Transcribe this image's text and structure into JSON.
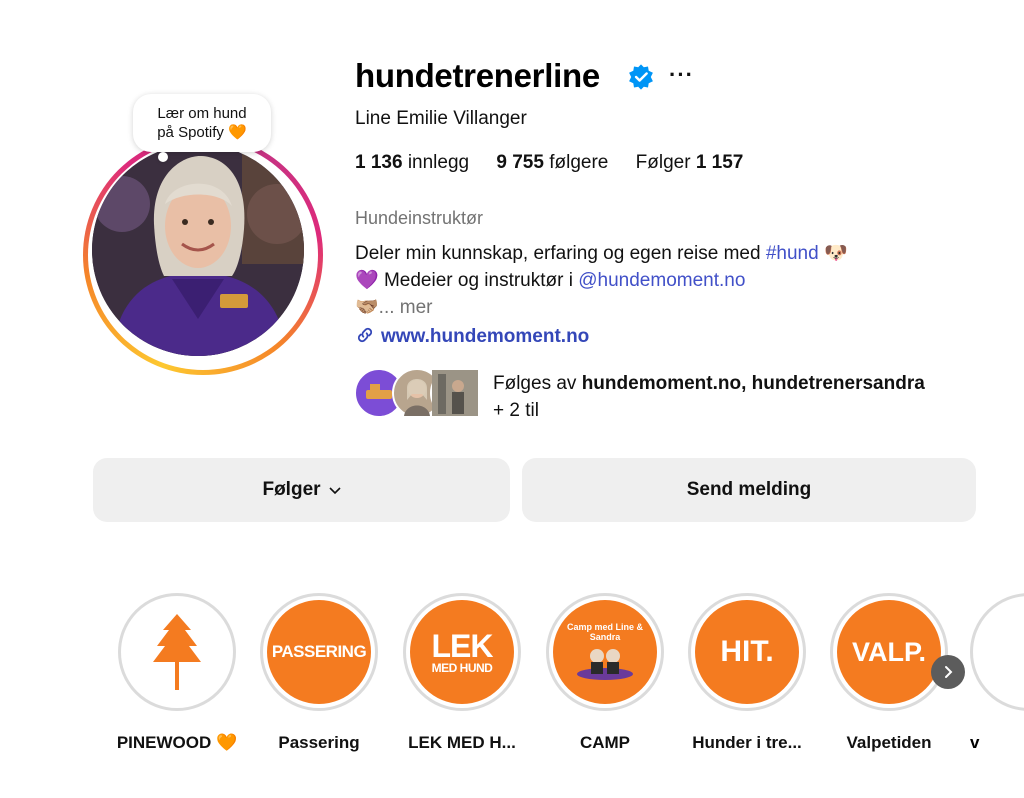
{
  "profile": {
    "username": "hundetrenerline",
    "more_icon": "···",
    "full_name": "Line Emilie Villanger",
    "note_line1": "Lær om hund",
    "note_line2": "på Spotify 🧡",
    "stats": {
      "posts_value": "1 136",
      "posts_label": "innlegg",
      "followers_value": "9 755",
      "followers_label": "følgere",
      "following_label": "Følger",
      "following_value": "1 157"
    },
    "category": "Hundeinstruktør",
    "bio": {
      "line1_text": "Deler min kunnskap, erfaring og egen reise med ",
      "line1_hashtag": "#hund",
      "line1_emoji": "🐶",
      "line2_emoji": "💜",
      "line2_text": " Medeier og instruktør i ",
      "line2_mention": "@hundemoment.no",
      "line3_emoji": "🫱🏼‍🫲🏽",
      "line3_more": "... mer"
    },
    "website": "www.hundemoment.no",
    "followed_by": {
      "prefix": "Følges av ",
      "names": "hundemoment.no, hundetrenersandra",
      "suffix": "+ 2 til"
    }
  },
  "buttons": {
    "follow_label": "Følger",
    "message_label": "Send melding"
  },
  "highlights": [
    {
      "label": "PINEWOOD 🧡",
      "cover_text": ""
    },
    {
      "label": "Passering",
      "cover_text": "PASSERING"
    },
    {
      "label": "LEK MED H...",
      "cover_text_line1": "LEK",
      "cover_text_line2": "MED HUND"
    },
    {
      "label": "CAMP",
      "cover_text": "Camp med Line & Sandra"
    },
    {
      "label": "Hunder i tre...",
      "cover_text": "HIT."
    },
    {
      "label": "Valpetiden",
      "cover_text": "VALP."
    },
    {
      "label": "v"
    }
  ],
  "colors": {
    "accent_blue": "#3447b8",
    "highlight_orange": "#f47b20",
    "verified_blue": "#0095f6"
  }
}
